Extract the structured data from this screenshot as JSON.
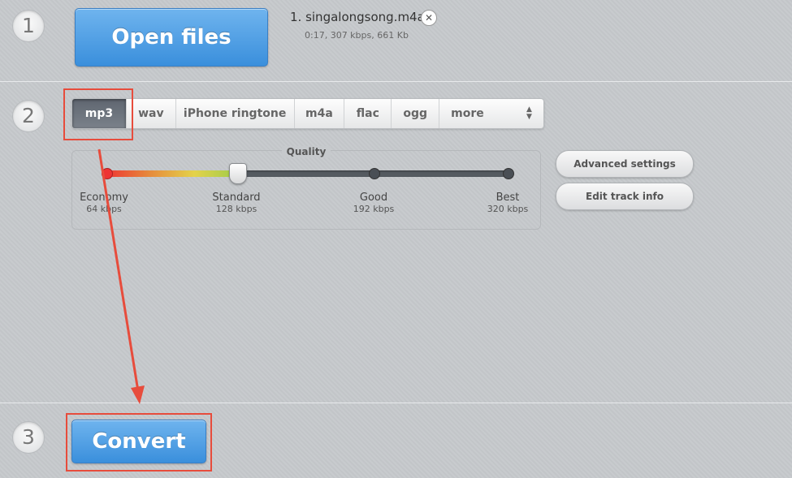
{
  "steps": {
    "one": "1",
    "two": "2",
    "three": "3"
  },
  "open_files_label": "Open files",
  "file": {
    "name": "1. singalongsong.m4a",
    "meta": "0:17, 307 kbps, 661 Kb"
  },
  "format_tabs": [
    {
      "label": "mp3",
      "active": true
    },
    {
      "label": "wav"
    },
    {
      "label": "iPhone ringtone"
    },
    {
      "label": "m4a"
    },
    {
      "label": "flac"
    },
    {
      "label": "ogg"
    },
    {
      "label": "more"
    }
  ],
  "quality": {
    "title": "Quality",
    "selected_level": "Standard",
    "levels": [
      {
        "name": "Economy",
        "kbps": "64 kbps"
      },
      {
        "name": "Standard",
        "kbps": "128 kbps"
      },
      {
        "name": "Good",
        "kbps": "192 kbps"
      },
      {
        "name": "Best",
        "kbps": "320 kbps"
      }
    ]
  },
  "advanced_settings_label": "Advanced settings",
  "edit_track_info_label": "Edit track info",
  "convert_label": "Convert",
  "colors": {
    "accent_blue": "#3a8fdc",
    "annotation_red": "#e74c3c"
  }
}
